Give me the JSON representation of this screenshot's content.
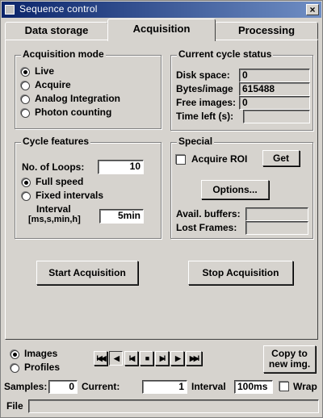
{
  "window": {
    "title": "Sequence control",
    "close_glyph": "×"
  },
  "tabs": [
    {
      "label": "Data storage"
    },
    {
      "label": "Acquisition"
    },
    {
      "label": "Processing"
    }
  ],
  "acquisition_mode": {
    "title": "Acquisition mode",
    "options": [
      "Live",
      "Acquire",
      "Analog Integration",
      "Photon counting"
    ],
    "selected": "Live"
  },
  "cycle_status": {
    "title": "Current cycle status",
    "rows": [
      {
        "label": "Disk space:",
        "value": "0"
      },
      {
        "label": "Bytes/image",
        "value": "615488"
      },
      {
        "label": "Free images:",
        "value": "0"
      },
      {
        "label": "Time left (s):",
        "value": ""
      }
    ]
  },
  "cycle_features": {
    "title": "Cycle features",
    "loops_label": "No. of Loops:",
    "loops_value": "10",
    "full_speed": "Full speed",
    "fixed_intervals": "Fixed intervals",
    "interval_label_1": "Interval",
    "interval_label_2": "[ms,s,min,h]",
    "interval_value": "5min",
    "selected": "Full speed"
  },
  "special": {
    "title": "Special",
    "acquire_roi": "Acquire ROI",
    "get_label": "Get",
    "options_label": "Options...",
    "avail_buffers": "Avail. buffers:",
    "avail_buffers_value": "",
    "lost_frames": "Lost Frames:",
    "lost_frames_value": ""
  },
  "actions": {
    "start": "Start Acquisition",
    "stop": "Stop Acquisition"
  },
  "bottom": {
    "images": "Images",
    "profiles": "Profiles",
    "copy_line1": "Copy to",
    "copy_line2": "new img.",
    "samples_label": "Samples:",
    "samples_value": "0",
    "current_label": "Current:",
    "current_value": "1",
    "interval_label": "Interval",
    "interval_value": "100ms",
    "wrap_label": "Wrap",
    "file_label": "File",
    "file_value": ""
  },
  "nav_glyphs": {
    "first": "I◀◀",
    "prev_step": "◀",
    "prev": "I◀",
    "stop": "■",
    "next": "▶I",
    "next_step": "▶",
    "last": "▶▶I"
  }
}
